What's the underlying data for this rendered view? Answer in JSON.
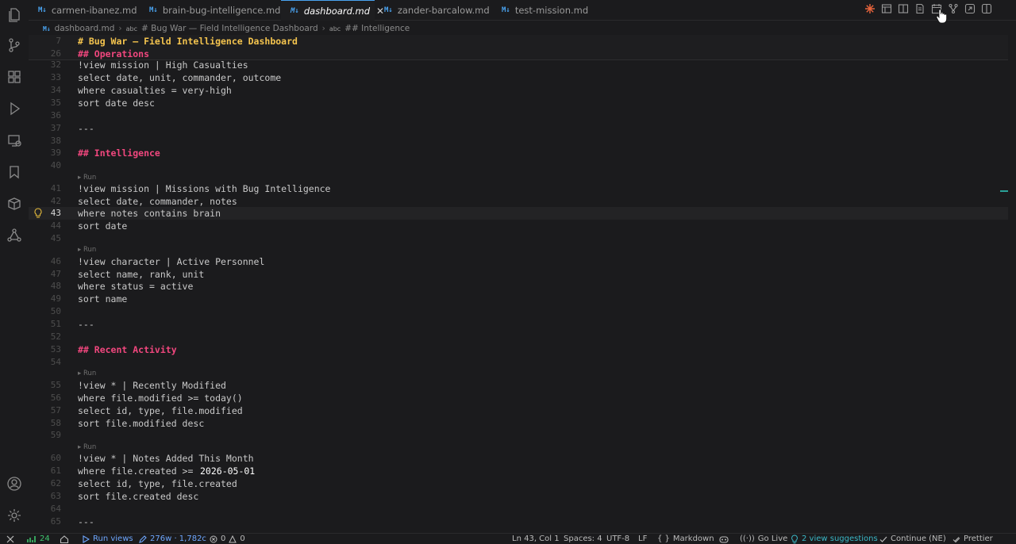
{
  "tabs": [
    {
      "label": "carmen-ibanez.md",
      "badge": "M↓"
    },
    {
      "label": "brain-bug-intelligence.md",
      "badge": "M↓"
    },
    {
      "label": "dashboard.md",
      "badge": "M↓"
    },
    {
      "label": "zander-barcalow.md",
      "badge": "M↓"
    },
    {
      "label": "test-mission.md",
      "badge": "M↓"
    }
  ],
  "active_tab_close": "✕",
  "breadcrumb": {
    "file": "dashboard.md",
    "file_badge": "M↓",
    "abc1": "abc",
    "section1": "# Bug War — Field Intelligence Dashboard",
    "abc2": "abc",
    "section2": "## Intelligence",
    "separator": "›"
  },
  "sticky": [
    {
      "ln": "7",
      "text": "# Bug War — Field Intelligence Dashboard"
    },
    {
      "ln": "26",
      "text": "## Operations"
    }
  ],
  "lines": [
    {
      "ln": "32",
      "text": "!view mission | High Casualties"
    },
    {
      "ln": "33",
      "text": "select date, unit, commander, outcome"
    },
    {
      "ln": "34",
      "text": "where casualties = very-high"
    },
    {
      "ln": "35",
      "text": "sort date desc"
    },
    {
      "ln": "36",
      "text": ""
    },
    {
      "ln": "37",
      "text": "---"
    },
    {
      "ln": "38",
      "text": ""
    },
    {
      "ln": "39",
      "text": "## Intelligence"
    },
    {
      "ln": "40",
      "text": ""
    },
    {
      "ln": "41",
      "text": "!view mission | Missions with Bug Intelligence"
    },
    {
      "ln": "42",
      "text": "select date, commander, notes"
    },
    {
      "ln": "43",
      "text": "where notes contains brain"
    },
    {
      "ln": "44",
      "text": "sort date"
    },
    {
      "ln": "45",
      "text": ""
    },
    {
      "ln": "46",
      "text": "!view character | Active Personnel"
    },
    {
      "ln": "47",
      "text": "select name, rank, unit"
    },
    {
      "ln": "48",
      "text": "where status = active"
    },
    {
      "ln": "49",
      "text": "sort name"
    },
    {
      "ln": "50",
      "text": ""
    },
    {
      "ln": "51",
      "text": "---"
    },
    {
      "ln": "52",
      "text": ""
    },
    {
      "ln": "53",
      "text": "## Recent Activity"
    },
    {
      "ln": "54",
      "text": ""
    },
    {
      "ln": "55",
      "text": "!view * | Recently Modified"
    },
    {
      "ln": "56",
      "text": "where file.modified >= today()"
    },
    {
      "ln": "57",
      "text": "select id, type, file.modified"
    },
    {
      "ln": "58",
      "text": "sort file.modified desc"
    },
    {
      "ln": "59",
      "text": ""
    },
    {
      "ln": "60",
      "text": "!view * | Notes Added This Month"
    },
    {
      "ln": "61",
      "text": "where file.created >= ",
      "date": "2026-05-01"
    },
    {
      "ln": "62",
      "text": "select id, type, file.created"
    },
    {
      "ln": "63",
      "text": "sort file.created desc"
    },
    {
      "ln": "64",
      "text": ""
    },
    {
      "ln": "65",
      "text": "---"
    }
  ],
  "run_label": "▸ Run",
  "status": {
    "branch_count": "24",
    "run_views": "Run views",
    "word_count": "276w · 1,782c",
    "problems": "0",
    "warnings": "0",
    "position": "Ln 43, Col 1",
    "spaces": "Spaces: 4",
    "encoding": "UTF-8",
    "eol": "LF",
    "language": "Markdown",
    "go_live": "Go Live",
    "suggestions": "2 view suggestions",
    "continue": "Continue (NE)",
    "prettier": "Prettier"
  },
  "colors": {
    "accent": "#4aa3f0",
    "heading1": "#f4c44e",
    "heading2": "#f1477e",
    "background": "#1b1b1d"
  }
}
